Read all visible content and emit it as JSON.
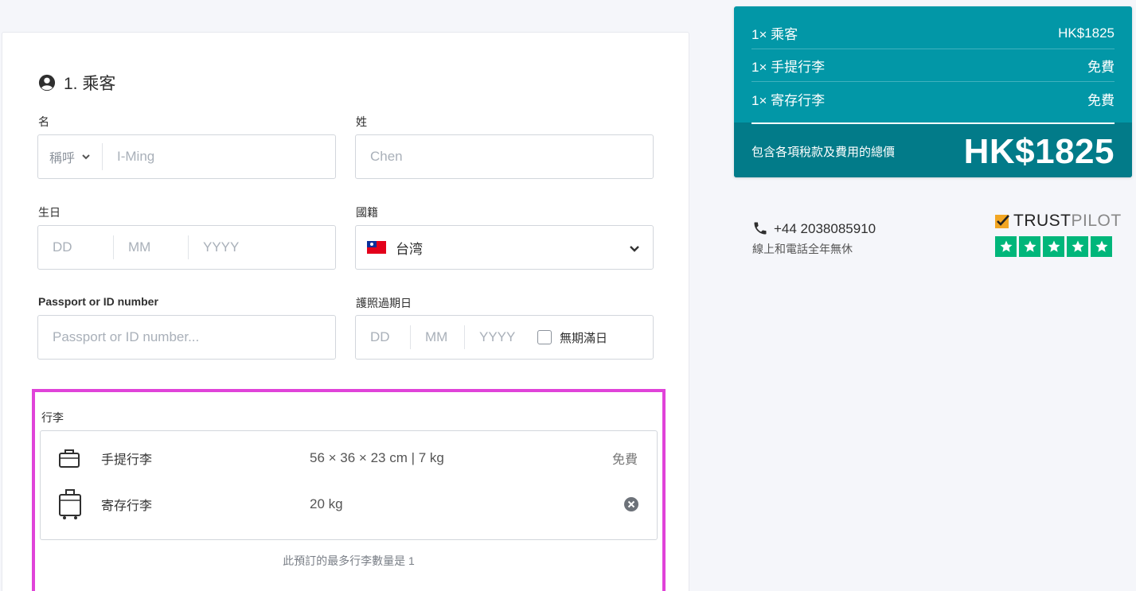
{
  "passenger_section": {
    "title": "1. 乘客",
    "first_name": {
      "label": "名",
      "title_select": "稱呼",
      "placeholder": "I-Ming"
    },
    "last_name": {
      "label": "姓",
      "placeholder": "Chen"
    },
    "dob": {
      "label": "生日",
      "dd": "DD",
      "mm": "MM",
      "yyyy": "YYYY"
    },
    "nationality": {
      "label": "國籍",
      "value": "台湾"
    },
    "passport": {
      "label": "Passport or ID number",
      "placeholder": "Passport or ID number..."
    },
    "passport_expiry": {
      "label": "護照過期日",
      "dd": "DD",
      "mm": "MM",
      "yyyy": "YYYY",
      "no_expiry_label": "無期滿日"
    }
  },
  "baggage": {
    "label": "行李",
    "items": [
      {
        "name": "手提行李",
        "dims": "56 × 36 × 23 cm | 7 kg",
        "price": "免費"
      },
      {
        "name": "寄存行李",
        "dims": "20 kg",
        "price": ""
      }
    ],
    "note": "此預訂的最多行李數量是 1"
  },
  "summary": {
    "rows": [
      {
        "label": "1× 乘客",
        "value": "HK$1825"
      },
      {
        "label": "1× 手提行李",
        "value": "免費"
      },
      {
        "label": "1× 寄存行李",
        "value": "免費"
      }
    ],
    "total_label": "包含各項稅款及費用的總價",
    "total_value": "HK$1825"
  },
  "contact": {
    "phone": "+44 2038085910",
    "hours": "線上和電話全年無休"
  },
  "trustpilot": {
    "brand_a": "TRUST",
    "brand_b": "PILOT",
    "stars": 5
  },
  "colors": {
    "summary_bg": "#0297a7",
    "summary_bottom": "#027b89",
    "highlight": "#e043d9",
    "trustpilot_green": "#00b67a"
  }
}
